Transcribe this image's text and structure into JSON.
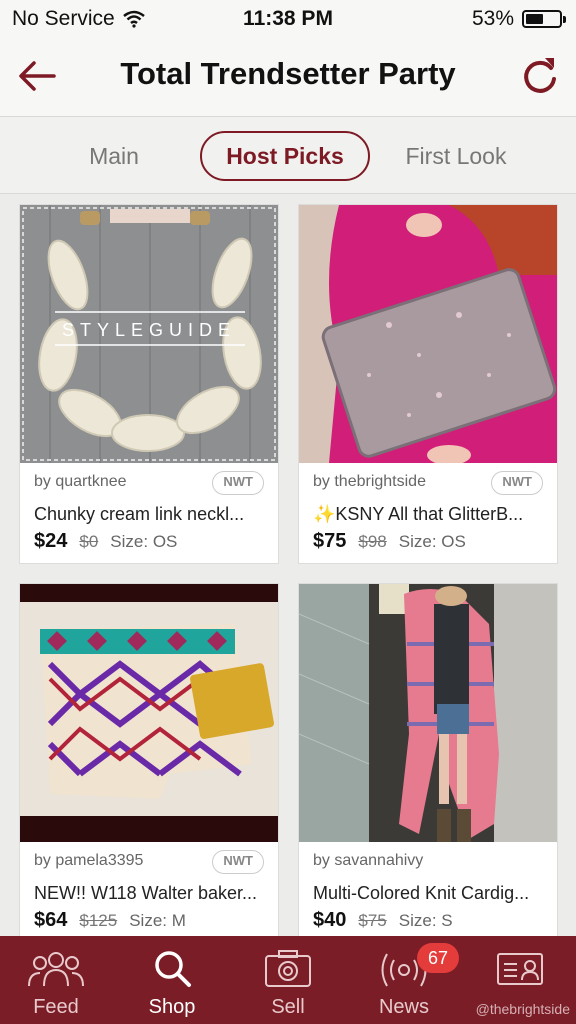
{
  "status_bar": {
    "carrier": "No Service",
    "time": "11:38 PM",
    "battery": "53%",
    "battery_level": 0.53
  },
  "nav": {
    "title": "Total Trendsetter Party",
    "back_icon": "back-arrow-icon",
    "refresh_icon": "refresh-icon"
  },
  "tabs": [
    "Main",
    "Host Picks",
    "First Look"
  ],
  "active_tab": "Host Picks",
  "listings": [
    {
      "by": "by quartknee",
      "badge": "NWT",
      "title": "Chunky cream link neckl...",
      "price": "$24",
      "original_price": "$0",
      "size": "Size: OS",
      "image_watermark": "STYLEGUIDE"
    },
    {
      "by": "by thebrightside",
      "badge": "NWT",
      "title": "✨KSNY All that GlitterB...",
      "price": "$75",
      "original_price": "$98",
      "size": "Size: OS"
    },
    {
      "by": "by pamela3395",
      "badge": "NWT",
      "title": "NEW!! W118 Walter baker...",
      "price": "$64",
      "original_price": "$125",
      "size": "Size: M"
    },
    {
      "by": "by savannahivy",
      "title": "Multi-Colored Knit Cardig...",
      "price": "$40",
      "original_price": "$75",
      "size": "Size: S"
    }
  ],
  "tabbar": {
    "items": [
      {
        "label": "Feed",
        "icon": "people-icon"
      },
      {
        "label": "Shop",
        "icon": "search-icon"
      },
      {
        "label": "Sell",
        "icon": "camera-icon"
      },
      {
        "label": "News",
        "icon": "broadcast-icon"
      },
      {
        "label": "",
        "icon": "profile-card-icon"
      }
    ],
    "active": "Shop",
    "news_badge": "67"
  },
  "watermark": "@thebrightside",
  "colors": {
    "brand": "#7a1d27",
    "accent": "#7d1a24",
    "badge": "#e43b3b"
  }
}
